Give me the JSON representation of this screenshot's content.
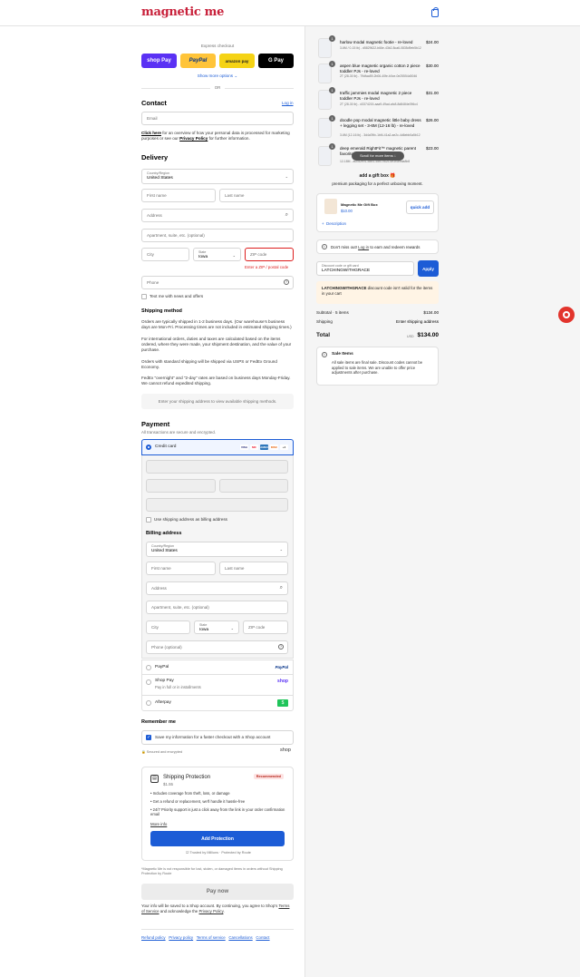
{
  "header": {
    "logo": "magnetic me",
    "cart_icon": "shopping-bag-icon"
  },
  "express": {
    "title": "Express checkout",
    "buttons": [
      {
        "label": "shop Pay",
        "color": "#5a31f4"
      },
      {
        "label": "PayPal",
        "color": "#ffc439"
      },
      {
        "label": "amazon pay",
        "color": "#f5d315"
      },
      {
        "label": "G Pay",
        "color": "#000000"
      }
    ],
    "show_more": "Show more options",
    "or": "OR"
  },
  "contact": {
    "title": "Contact",
    "login": "Log in",
    "email_placeholder": "Email",
    "notice_link": "Click here",
    "notice_text": " for an overview of how your personal data is processed for marketing purposes or see our ",
    "privacy_link": "Privacy Policy",
    "notice_end": " for further information."
  },
  "delivery": {
    "title": "Delivery",
    "country_label": "Country/Region",
    "country_value": "United States",
    "first_name": "First name",
    "last_name": "Last name",
    "address": "Address",
    "apartment": "Apartment, suite, etc. (optional)",
    "city": "City",
    "state_label": "State",
    "state_value": "Iowa",
    "zip": "ZIP code",
    "zip_error": "Enter a ZIP / postal code",
    "phone": "Phone",
    "text_me": "Text me with news and offers"
  },
  "shipping_method": {
    "title": "Shipping method",
    "p1": "Orders are typically shipped in 1-2 business days. (Our warehouse's business days are Mon-Fri. Processing times are not included in estimated shipping times.)",
    "p2": "For international orders, duties and taxes are calculated based on the items ordered, where they were made, your shipment destination, and the value of your purchase.",
    "p3": "Orders with standard shipping will be shipped via USPS or FedEx Ground Economy.",
    "p4": "FedEx \"overnight\" and \"2-day\" rates are based on business days Monday-Friday. We cannot refund expedited shipping.",
    "placeholder": "Enter your shipping address to view available shipping methods."
  },
  "payment": {
    "title": "Payment",
    "subtitle": "All transactions are secure and encrypted.",
    "credit_card": "Credit card",
    "card_icons": [
      "VISA",
      "MC",
      "AMEX",
      "DISC",
      "+4"
    ],
    "use_shipping": "Use shipping address as billing address",
    "billing_title": "Billing address",
    "country_label": "Country/Region",
    "country_value": "United States",
    "first_name": "First name",
    "last_name": "Last name",
    "address": "Address",
    "apartment": "Apartment, suite, etc. (optional)",
    "city": "City",
    "state_label": "State",
    "state_value": "Iowa",
    "zip": "ZIP code",
    "phone": "Phone (optional)",
    "paypal": "PayPal",
    "paypal_logo": "PayPal",
    "shoppay": "Shop Pay",
    "shoppay_sub": "Pay in full or in installments",
    "shoppay_logo": "shop",
    "afterpay": "Afterpay"
  },
  "remember": {
    "title": "Remember me",
    "save_info": "Save my information for a faster checkout with a Shop account",
    "secure": "Secured and encrypted",
    "shop_logo": "shop"
  },
  "protection": {
    "title": "Shipping Protection",
    "price": "$1.55",
    "badge": "Recommended",
    "bullets": [
      "Includes coverage from theft, loss, or damage",
      "Get a refund or replacement, we'll handle it hassle-free",
      "24/7 Priority support is just a click away from the link in your order confirmation email"
    ],
    "more_info": "More info",
    "add_button": "Add Protection",
    "trusted": "Trusted by Millions · Protected by Route",
    "disclaimer": "*Magnetic Me is not responsible for lost, stolen, or damaged items in orders without Shipping Protection by Route"
  },
  "pay_now": "Pay now",
  "shop_notice_1": "Your info will be saved to a Shop account. By continuing, you agree to Shop's ",
  "shop_terms": "Terms of Service",
  "shop_notice_2": " and acknowledge the ",
  "shop_privacy": "Privacy Policy",
  "shop_notice_3": ".",
  "footer_links": [
    "Refund policy",
    "Privacy policy",
    "Terms of service",
    "Cancellations",
    "Contact"
  ],
  "order": {
    "items": [
      {
        "qty": "1",
        "name": "harlow modal magnetic footie - re-loved",
        "sub": "3-6M / 0-15 lb) - d5829622-b66e-43b2-8ca6-0835d9eb5b12",
        "price": "$24.00"
      },
      {
        "qty": "1",
        "name": "aspen blue magnetic organic cotton 2 piece toddler PJs - re-loved",
        "sub": "2T (28-30 lb) - 79dfaa59-2b06-40fe-b0ce-0e25554d0046",
        "price": "$30.00"
      },
      {
        "qty": "1",
        "name": "traffic jammies modal magnetic 2 piece toddler PJs - re-loved",
        "sub": "2T (28-30 lb) - d3374215-aaa9-49ad-afc8-8d8484e096c4",
        "price": "$31.00"
      },
      {
        "qty": "1",
        "name": "doodle pop modal magnetic little baby dress + legging set - 3-6M (12-16 lb) - re-loved",
        "sub": "3-6M (12-16 lb) - 3d4c09fc-1bf4-41a2-ae2c-4d6ebb0a5b12",
        "price": "$26.00"
      },
      {
        "qty": "1",
        "name": "deep emerald RightFit™ magnetic parent favorite",
        "sub": "12-18M - a0cd2e91-58b4-4df0-962c-5e3f4b9da8b8",
        "price": "$23.00"
      }
    ],
    "scroll_tip": "Scroll for more items",
    "gift_title": "add a gift box 🎁",
    "gift_sub": "premium packaging for a perfect unboxing moment.",
    "gift_name": "Magnetic Me Gift Box",
    "gift_price": "$10.00",
    "quick_add": "quick add",
    "description": "Description",
    "rewards_text": "Don't miss out! ",
    "rewards_link": "Log in",
    "rewards_end": " to earn and redeem rewards",
    "discount_label": "Discount code or gift card",
    "discount_value": "LATCHINGWITHGRACE",
    "apply": "Apply",
    "discount_error_code": "LATCHINGWITHGRACE",
    "discount_error_text": " discount code isn't valid for the items in your cart",
    "subtotal_label": "Subtotal · 5 items",
    "subtotal_value": "$134.00",
    "shipping_label": "Shipping",
    "shipping_value": "Enter shipping address",
    "total_label": "Total",
    "currency": "USD",
    "total_value": "$134.00",
    "sale_title": "Sale Items",
    "sale_text": "All sale items are final sale. Discount codes cannot be applied to sale items. We are unable to offer price adjustments after purchase."
  },
  "colors": {
    "brand": "#c8203a",
    "accent": "#1c5cd6",
    "error": "#dd1d1d"
  }
}
